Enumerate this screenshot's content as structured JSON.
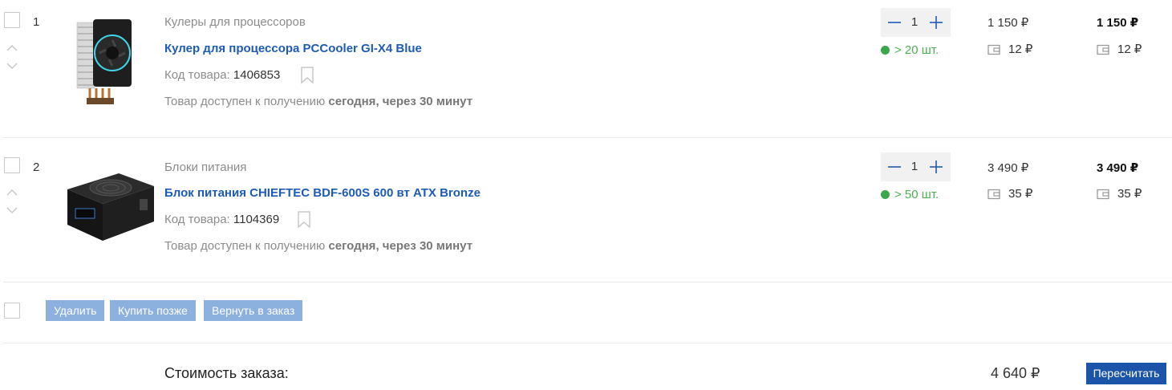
{
  "items": [
    {
      "index": "1",
      "category": "Кулеры для процессоров",
      "title": "Кулер для процессора PCCooler GI-X4 Blue",
      "code_label": "Код товара:",
      "code": "1406853",
      "availability_prefix": "Товар доступен к получению",
      "availability_strong": "сегодня, через 30 минут",
      "quantity": "1",
      "stock": "> 20 шт.",
      "price": "1 150 ₽",
      "bonus_unit": "12 ₽",
      "total": "1 150 ₽",
      "bonus_total": "12 ₽",
      "image_icon": "cpu-cooler-image"
    },
    {
      "index": "2",
      "category": "Блоки питания",
      "title": "Блок питания CHIEFTEC BDF-600S 600 вт ATX Bronze",
      "code_label": "Код товара:",
      "code": "1104369",
      "availability_prefix": "Товар доступен к получению",
      "availability_strong": "сегодня, через 30 минут",
      "quantity": "1",
      "stock": "> 50 шт.",
      "price": "3 490 ₽",
      "bonus_unit": "35 ₽",
      "total": "3 490 ₽",
      "bonus_total": "35 ₽",
      "image_icon": "power-supply-image"
    }
  ],
  "actions": {
    "delete": "Удалить",
    "buy_later": "Купить позже",
    "return_to_order": "Вернуть в заказ"
  },
  "summary": {
    "label": "Стоимость заказа:",
    "value": "4 640 ₽",
    "recalculate": "Пересчитать"
  },
  "colors": {
    "link": "#1e5bb6",
    "stock": "#3ca64a",
    "light_button": "#8db1de",
    "primary_button": "#1b54a8",
    "qty_background": "#f1f1f1"
  }
}
